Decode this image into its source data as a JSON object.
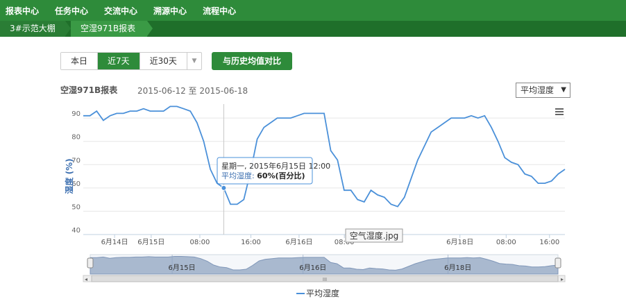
{
  "nav": {
    "items": [
      "报表中心",
      "任务中心",
      "交流中心",
      "溯源中心",
      "流程中心"
    ]
  },
  "breadcrumb": {
    "items": [
      "3#示范大棚",
      "空湿971B报表"
    ]
  },
  "toolbar": {
    "ranges": [
      "本日",
      "近7天",
      "近30天"
    ],
    "active_range": "近7天",
    "compare_label": "与历史均值对比"
  },
  "report": {
    "title": "空湿971B报表",
    "date_range": "2015-06-12 至 2015-06-18",
    "metric_select": "平均湿度"
  },
  "tooltip": {
    "date": "星期一, 2015年6月15日 12:00",
    "series_label": "平均湿度: ",
    "value": "60%(百分比)"
  },
  "overlay_file_label": "空气湿度.jpg",
  "navigator_scroll_label": "III",
  "colors": {
    "nav_green": "#2e8b3a",
    "line": "#4a90d9",
    "navigator_fill": "#a9b9cf"
  },
  "chart_data": {
    "type": "line",
    "ylabel": "湿度 (%)",
    "yticks": [
      40,
      50,
      60,
      70,
      80,
      90
    ],
    "ylim": [
      40,
      96
    ],
    "xticks": [
      "6月14日",
      "6月15日",
      "08:00",
      "16:00",
      "6月16日",
      "08:00",
      "6月18日",
      "08:00",
      "16:00"
    ],
    "navigator_labels": [
      "6月15日",
      "6月16日",
      "6月18日"
    ],
    "legend": "平均湿度",
    "series": [
      {
        "name": "平均湿度",
        "values": [
          91,
          91,
          93,
          89,
          91,
          92,
          92,
          93,
          93,
          94,
          93,
          93,
          93,
          95,
          95,
          94,
          93,
          88,
          80,
          68,
          62,
          60,
          53,
          53,
          55,
          67,
          81,
          86,
          88,
          90,
          90,
          90,
          91,
          92,
          92,
          92,
          92,
          76,
          72,
          59,
          59,
          55,
          54,
          59,
          57,
          56,
          53,
          52,
          56,
          64,
          72,
          78,
          84,
          86,
          88,
          90,
          90,
          90,
          91,
          90,
          91,
          86,
          80,
          73,
          71,
          70,
          66,
          65,
          62,
          62,
          63,
          66,
          68
        ]
      }
    ]
  }
}
